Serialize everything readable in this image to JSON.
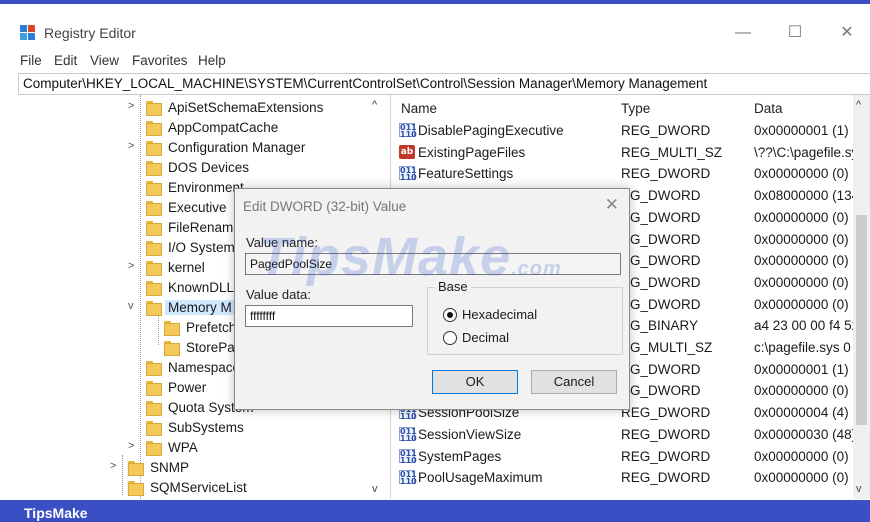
{
  "window": {
    "title": "Registry Editor",
    "minimize": "—",
    "maximize": "☐",
    "close": "✕"
  },
  "menu": [
    "File",
    "Edit",
    "View",
    "Favorites",
    "Help"
  ],
  "address": "Computer\\HKEY_LOCAL_MACHINE\\SYSTEM\\CurrentControlSet\\Control\\Session Manager\\Memory Management",
  "tree": [
    "ApiSetSchemaExtensions",
    "AppCompatCache",
    "Configuration Manager",
    "DOS Devices",
    "Environment",
    "Executive",
    "FileRename",
    "I/O System",
    "kernel",
    "KnownDLLs",
    "Memory M",
    "Prefetch",
    "StorePar",
    "Namespace",
    "Power",
    "Quota System",
    "SubSystems",
    "WPA",
    "SNMP",
    "SQMServiceList"
  ],
  "list": {
    "headers": {
      "name": "Name",
      "type": "Type",
      "data": "Data"
    },
    "rows": [
      {
        "icon": "dword",
        "name": "DisablePagingExecutive",
        "type": "REG_DWORD",
        "data": "0x00000001 (1)"
      },
      {
        "icon": "sz",
        "name": "ExistingPageFiles",
        "type": "REG_MULTI_SZ",
        "data": "\\??\\C:\\pagefile.sy"
      },
      {
        "icon": "dword",
        "name": "FeatureSettings",
        "type": "REG_DWORD",
        "data": "0x00000000 (0)"
      },
      {
        "icon": "dword",
        "name": "",
        "type": "EG_DWORD",
        "data": "0x08000000 (134"
      },
      {
        "icon": "dword",
        "name": "",
        "type": "EG_DWORD",
        "data": "0x00000000 (0)"
      },
      {
        "icon": "dword",
        "name": "",
        "type": "EG_DWORD",
        "data": "0x00000000 (0)"
      },
      {
        "icon": "dword",
        "name": "",
        "type": "EG_DWORD",
        "data": "0x00000000 (0)"
      },
      {
        "icon": "dword",
        "name": "",
        "type": "EG_DWORD",
        "data": "0x00000000 (0)"
      },
      {
        "icon": "dword",
        "name": "",
        "type": "EG_DWORD",
        "data": "0x00000000 (0)"
      },
      {
        "icon": "dword",
        "name": "",
        "type": "EG_BINARY",
        "data": "a4 23 00 00 f4 52"
      },
      {
        "icon": "dword",
        "name": "",
        "type": "EG_MULTI_SZ",
        "data": "c:\\pagefile.sys 0 ("
      },
      {
        "icon": "dword",
        "name": "",
        "type": "EG_DWORD",
        "data": "0x00000001 (1)"
      },
      {
        "icon": "dword",
        "name": "",
        "type": "EG_DWORD",
        "data": "0x00000000 (0)"
      },
      {
        "icon": "dword",
        "name": "SessionPoolSize",
        "type": "REG_DWORD",
        "data": "0x00000004 (4)"
      },
      {
        "icon": "dword",
        "name": "SessionViewSize",
        "type": "REG_DWORD",
        "data": "0x00000030 (48)"
      },
      {
        "icon": "dword",
        "name": "SystemPages",
        "type": "REG_DWORD",
        "data": "0x00000000 (0)"
      },
      {
        "icon": "dword",
        "name": "PoolUsageMaximum",
        "type": "REG_DWORD",
        "data": "0x00000000 (0)"
      }
    ]
  },
  "dialog": {
    "title": "Edit DWORD (32-bit) Value",
    "close": "✕",
    "value_name_label": "Value name:",
    "value_name": "PagedPoolSize",
    "value_data_label": "Value data:",
    "value_data": "ffffffff",
    "base_label": "Base",
    "hex_label": "Hexadecimal",
    "dec_label": "Decimal",
    "selected_base": "Hexadecimal",
    "ok": "OK",
    "cancel": "Cancel"
  },
  "watermark": {
    "main": "TipsMake",
    "suffix": ".com"
  },
  "footer": "TipsMake",
  "colors": {
    "accent": "#3b4fc4",
    "selection": "#cde8ff",
    "folder": "#f3c95b"
  }
}
